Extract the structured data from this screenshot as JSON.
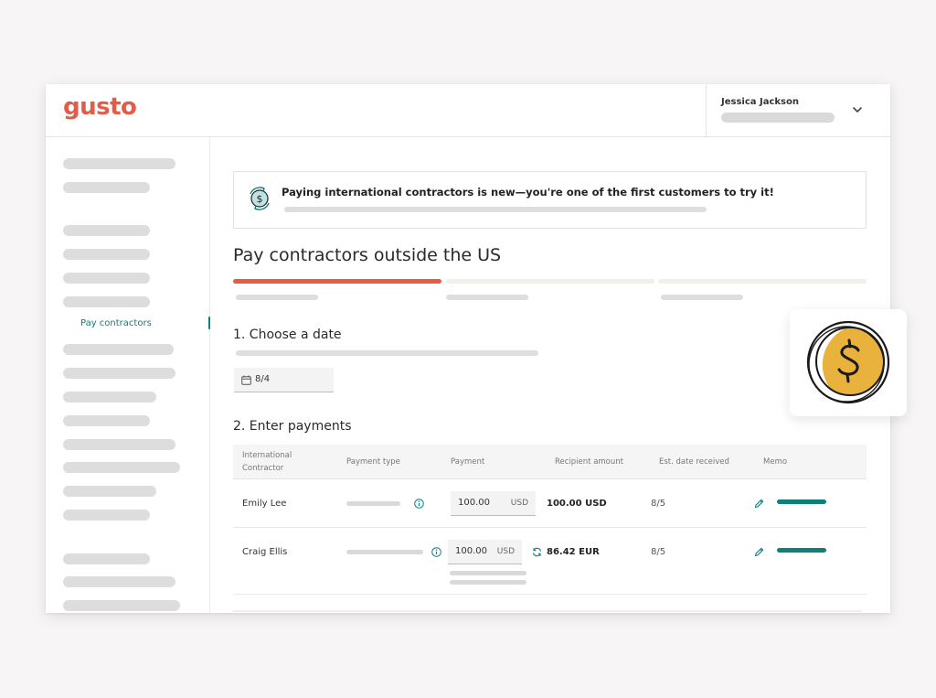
{
  "app": {
    "logo_text": "gusto",
    "brand_color": "#e35c47",
    "accent_color": "#0a7f86"
  },
  "header": {
    "user_name": "Jessica Jackson",
    "menu_icon": "chevron-down-icon"
  },
  "sidebar": {
    "active_item": "Pay contractors"
  },
  "banner": {
    "icon": "currency-exchange-icon",
    "message": "Paying international contractors is new—you're one of the first customers to try it!"
  },
  "page": {
    "title": "Pay contractors outside the US"
  },
  "steps": {
    "current_step": 1,
    "total_steps": 3
  },
  "section_date": {
    "title": "1. Choose a date",
    "date_value": "8/4",
    "icon": "calendar-icon"
  },
  "section_payments": {
    "title": "2. Enter payments",
    "columns": {
      "contractor_line1": "International",
      "contractor_line2": "Contractor",
      "payment_type": "Payment type",
      "payment": "Payment",
      "recipient_amount": "Recipient amount",
      "est_date": "Est. date received",
      "memo": "Memo"
    },
    "rows": [
      {
        "name": "Emily Lee",
        "payment_amount": "100.00",
        "payment_currency": "USD",
        "recipient_amount": "100.00 USD",
        "est_date": "8/5"
      },
      {
        "name": "Craig Ellis",
        "payment_amount": "100.00",
        "payment_currency": "USD",
        "recipient_amount": "86.42 EUR",
        "est_date": "8/5"
      }
    ]
  },
  "decoration": {
    "icon": "dollar-coin-icon",
    "coin_color": "#e8b23c"
  }
}
